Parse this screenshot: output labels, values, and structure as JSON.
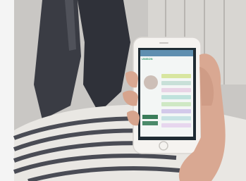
{
  "screen": {
    "brand": "UNISON",
    "subtitle": "",
    "profile_name": "",
    "bar_colors": [
      "#d8e6a0",
      "#c8e0d8",
      "#e8d4e6",
      "#bfe2dc",
      "#cfe8c4",
      "#d3c9ea",
      "#c7e3e4",
      "#e7d6ee"
    ]
  }
}
